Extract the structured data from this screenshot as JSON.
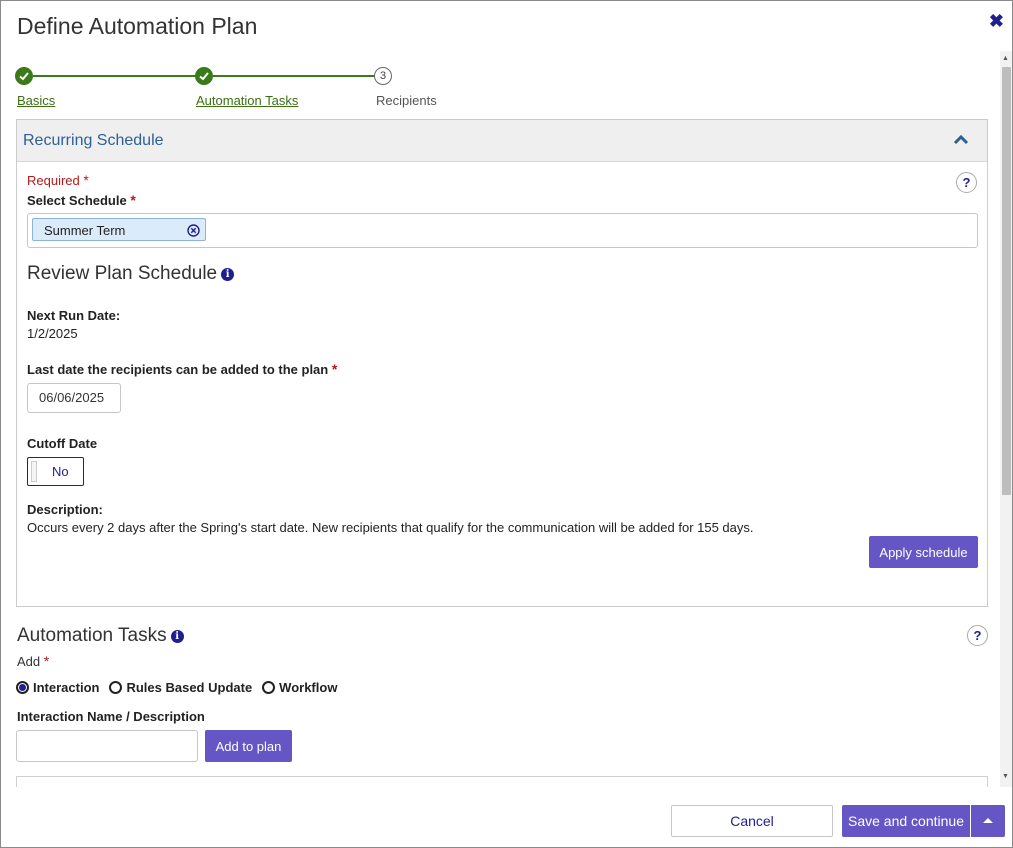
{
  "dialog": {
    "title": "Define Automation Plan"
  },
  "stepper": {
    "steps": [
      {
        "label": "Basics",
        "status": "complete"
      },
      {
        "label": "Automation Tasks",
        "status": "complete"
      },
      {
        "label": "Recipients",
        "status": "pending",
        "number": "3"
      }
    ]
  },
  "recurring": {
    "title": "Recurring Schedule",
    "required_label": "Required",
    "required_mark": "*",
    "select_schedule_label": "Select Schedule",
    "selected_chip": "Summer Term",
    "help_label": "?"
  },
  "review": {
    "title": "Review Plan Schedule",
    "info_glyph": "i",
    "next_run_label": "Next Run Date:",
    "next_run_value": "1/2/2025",
    "last_date_label": "Last date the recipients can be added to the plan",
    "last_date_value": "06/06/2025",
    "cutoff_label": "Cutoff Date",
    "cutoff_value": "No",
    "description_label": "Description:",
    "description_text": "Occurs every 2 days after the Spring's start date. New recipients that qualify for the communication will be added for 155 days.",
    "apply_button": "Apply schedule"
  },
  "automation": {
    "title": "Automation Tasks",
    "info_glyph": "i",
    "help_label": "?",
    "add_label": "Add",
    "radios": [
      {
        "label": "Interaction",
        "checked": true
      },
      {
        "label": "Rules Based Update",
        "checked": false
      },
      {
        "label": "Workflow",
        "checked": false
      }
    ],
    "name_label": "Interaction Name / Description",
    "name_value": "",
    "add_button": "Add to plan"
  },
  "footer": {
    "cancel_button": "Cancel",
    "save_button": "Save and continue"
  },
  "colors": {
    "accent": "#6555c5",
    "success": "#3b7a1a",
    "required": "#b3191b",
    "link": "#2e5f96",
    "navy": "#1f1f8f"
  }
}
